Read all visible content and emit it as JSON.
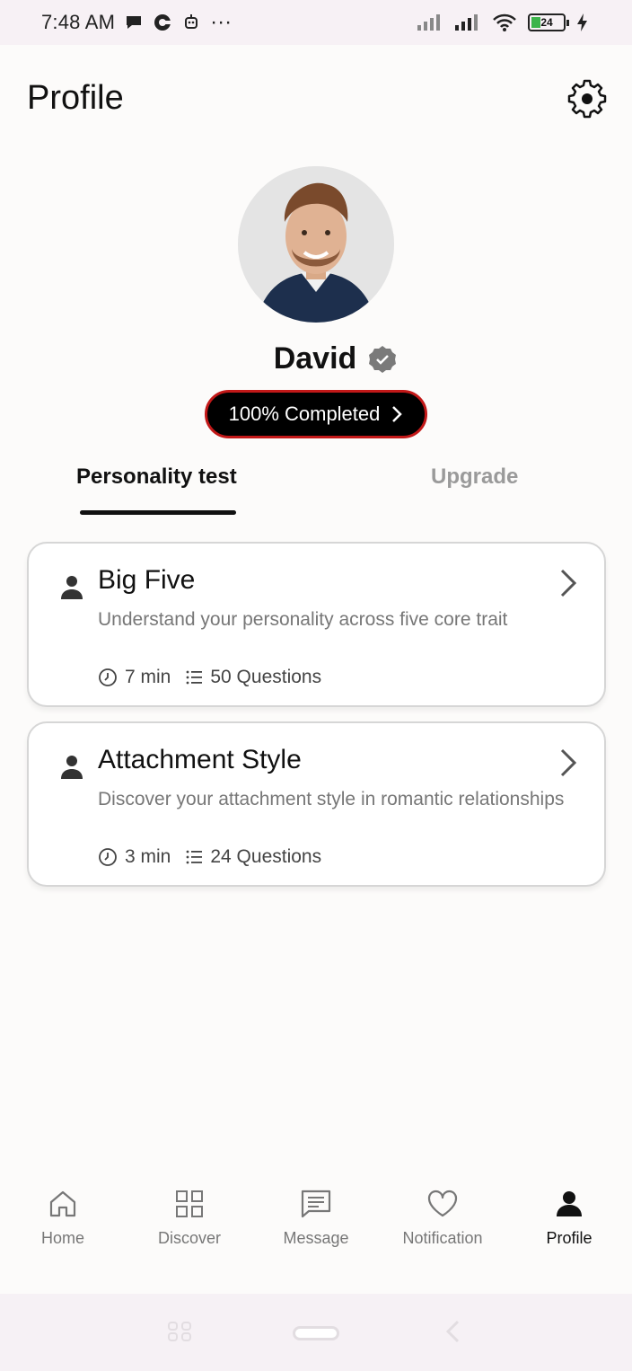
{
  "status_bar": {
    "time": "7:48 AM",
    "dots": "···",
    "battery": "24"
  },
  "header": {
    "title": "Profile",
    "settings_icon": "gear-icon"
  },
  "profile": {
    "name": "David",
    "verified_icon": "verified-badge-icon",
    "completion_label": "100% Completed"
  },
  "tabs": [
    {
      "label": "Personality test",
      "active": true
    },
    {
      "label": "Upgrade",
      "active": false
    }
  ],
  "tests": [
    {
      "title": "Big Five",
      "description": "Understand your personality across five core trait",
      "duration": "7 min",
      "questions": "50 Questions"
    },
    {
      "title": "Attachment Style",
      "description": "Discover your attachment style in romantic relationships",
      "duration": "3 min",
      "questions": "24 Questions"
    }
  ],
  "bottom_nav": [
    {
      "label": "Home",
      "icon": "home-icon"
    },
    {
      "label": "Discover",
      "icon": "grid-icon"
    },
    {
      "label": "Message",
      "icon": "message-icon"
    },
    {
      "label": "Notification",
      "icon": "heart-icon"
    },
    {
      "label": "Profile",
      "icon": "person-icon",
      "active": true
    }
  ],
  "colors": {
    "accent": "#111111",
    "completed_border": "#c21818",
    "inactive_tab": "#9a9a9a",
    "battery_fill": "#3cb44b"
  }
}
